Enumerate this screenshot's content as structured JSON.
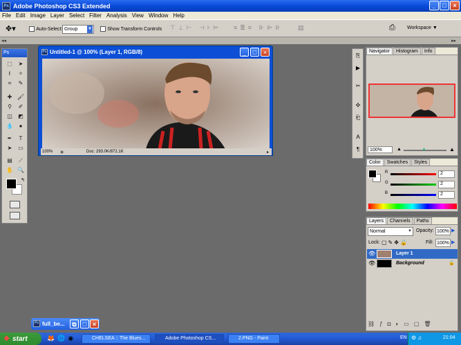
{
  "app": {
    "title": "Adobe Photoshop CS3 Extended",
    "icon": "ps-icon"
  },
  "menu": [
    "File",
    "Edit",
    "Image",
    "Layer",
    "Select",
    "Filter",
    "Analysis",
    "View",
    "Window",
    "Help"
  ],
  "options": {
    "auto_select_label": "Auto-Select:",
    "auto_select_value": "Group",
    "transform_label": "Show Transform Controls",
    "workspace_label": "Workspace"
  },
  "toolbox": {
    "logo": "Ps"
  },
  "document": {
    "title": "Untitled-1 @ 100% (Layer 1, RGB/8)",
    "zoom": "100%",
    "doc_info": "Doc: 293.0K/872.1K"
  },
  "navigator": {
    "tabs": [
      "Navigator",
      "Histogram",
      "Info"
    ],
    "zoom": "100%"
  },
  "color": {
    "tabs": [
      "Color",
      "Swatches",
      "Styles"
    ],
    "channels": [
      {
        "label": "R",
        "value": "2"
      },
      {
        "label": "G",
        "value": "2"
      },
      {
        "label": "B",
        "value": "2"
      }
    ]
  },
  "layers": {
    "tabs": [
      "Layers",
      "Channels",
      "Paths"
    ],
    "blend_mode": "Normal",
    "opacity_label": "Opacity:",
    "opacity": "100%",
    "lock_label": "Lock:",
    "fill_label": "Fill:",
    "fill": "100%",
    "items": [
      {
        "name": "Layer 1",
        "selected": true
      },
      {
        "name": "Background",
        "selected": false
      }
    ]
  },
  "mini_window": {
    "title": "full_be..."
  },
  "taskbar": {
    "start": "start",
    "tasks": [
      {
        "label": "CHELSEA :: The Blues...",
        "active": false
      },
      {
        "label": "Adobe Photoshop CS...",
        "active": true
      },
      {
        "label": "2.PNG - Paint",
        "active": false
      }
    ],
    "lang": "EN",
    "time": "21:04"
  },
  "colors": {
    "title_blue": "#0a4ad8",
    "selected_layer": "#316ac5",
    "panel_bg": "#d4d0c8"
  }
}
